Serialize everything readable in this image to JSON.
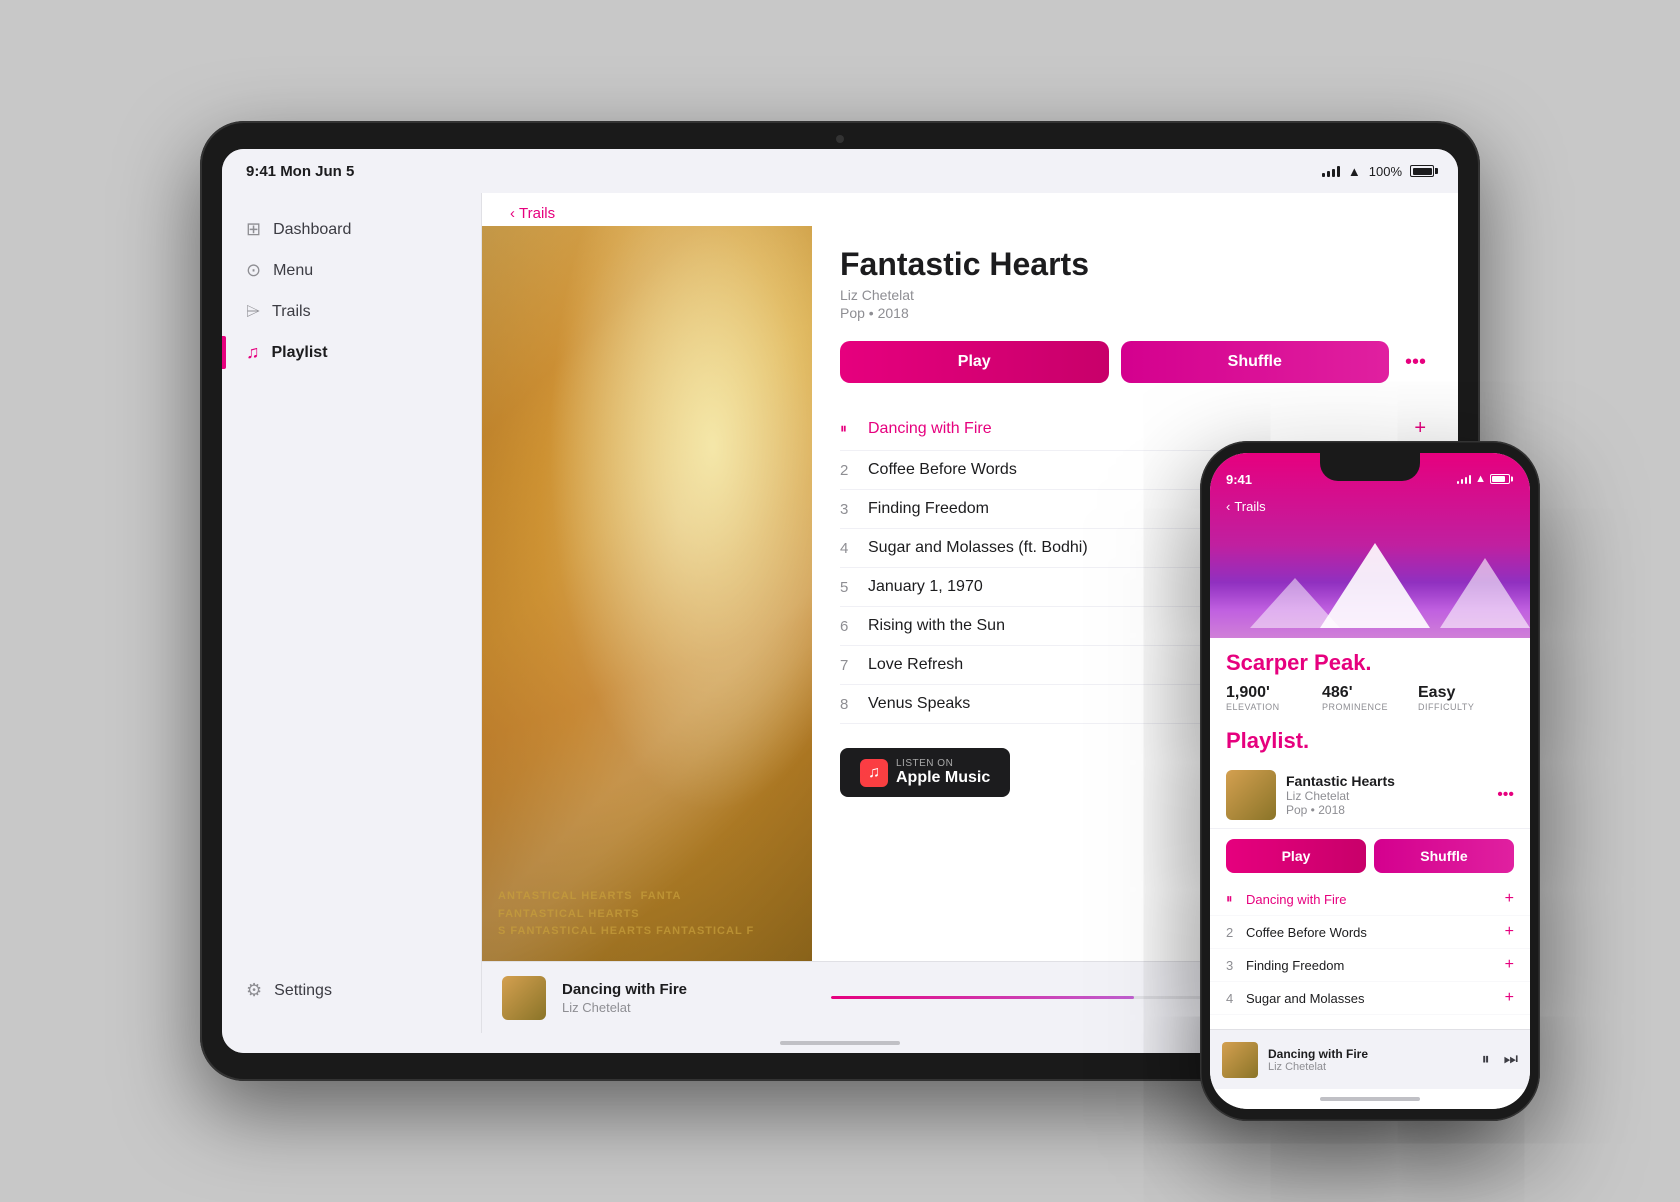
{
  "status_bar": {
    "time": "9:41 Mon Jun 5",
    "battery": "100%",
    "battery_level": 100
  },
  "sidebar": {
    "items": [
      {
        "id": "dashboard",
        "label": "Dashboard",
        "icon": "⊞"
      },
      {
        "id": "menu",
        "label": "Menu",
        "icon": "⊙"
      },
      {
        "id": "trails",
        "label": "Trails",
        "icon": "⌲"
      },
      {
        "id": "playlist",
        "label": "Playlist",
        "icon": "♫",
        "active": true
      }
    ],
    "settings_label": "Settings"
  },
  "back_nav": {
    "label": "Trails"
  },
  "album": {
    "title": "Fantastic Hearts",
    "artist": "Liz Chetelat",
    "genre": "Pop",
    "year": "2018",
    "meta": "Pop • 2018",
    "art_text": "ANTASTICAL HEARTS   FANTA\nFANTASTICAL HEARTS\nS FANTASTICAL HEARTS FANTASTICAL F"
  },
  "buttons": {
    "play": "Play",
    "shuffle": "Shuffle",
    "more": "•••"
  },
  "tracks": [
    {
      "num": "",
      "name": "Dancing with Fire",
      "playing": true
    },
    {
      "num": "2",
      "name": "Coffee Before Words",
      "playing": false
    },
    {
      "num": "3",
      "name": "Finding Freedom",
      "playing": false
    },
    {
      "num": "4",
      "name": "Sugar and Molasses (ft. Bodhi)",
      "playing": false
    },
    {
      "num": "5",
      "name": "January 1, 1970",
      "playing": false
    },
    {
      "num": "6",
      "name": "Rising with the Sun",
      "playing": false
    },
    {
      "num": "7",
      "name": "Love Refresh",
      "playing": false
    },
    {
      "num": "8",
      "name": "Venus Speaks",
      "playing": false
    }
  ],
  "apple_music": {
    "listen_on": "Listen on",
    "label": "Apple Music"
  },
  "now_playing": {
    "title": "Dancing with Fire",
    "artist": "Liz Chetelat",
    "progress": 60
  },
  "iphone": {
    "time": "9:41",
    "back_label": "Trails",
    "trail_title": "Scarper Peak.",
    "stats": [
      {
        "value": "1,900'",
        "label": "Elevation"
      },
      {
        "value": "486'",
        "label": "Prominence"
      },
      {
        "value": "Easy",
        "label": "Difficulty"
      }
    ],
    "playlist_section": "Playlist.",
    "album_title": "Fantastic Hearts",
    "album_artist": "Liz Chetelat",
    "album_meta": "Pop • 2018",
    "tracks": [
      {
        "num": "",
        "name": "Dancing with Fire",
        "playing": true
      },
      {
        "num": "2",
        "name": "Coffee Before Words",
        "playing": false
      },
      {
        "num": "3",
        "name": "Finding Freedom",
        "playing": false
      },
      {
        "num": "4",
        "name": "Sugar and Molasses",
        "playing": false
      }
    ],
    "now_playing": {
      "title": "Dancing with Fire",
      "artist": "Liz Chetelat"
    }
  }
}
